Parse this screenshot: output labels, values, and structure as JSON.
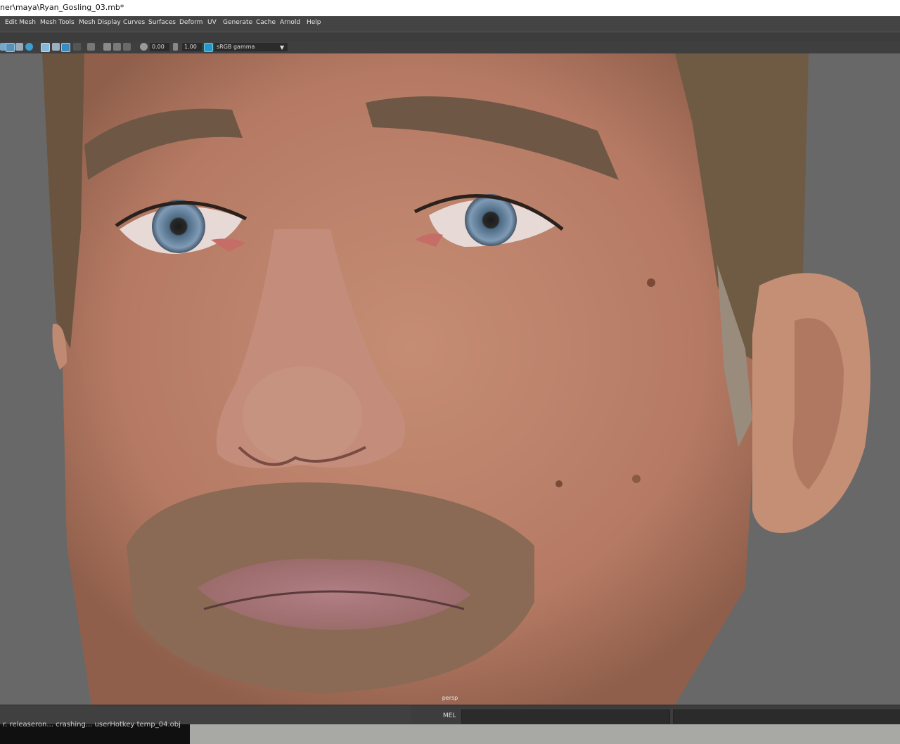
{
  "window": {
    "title": "ner\\maya\\Ryan_Gosling_03.mb*"
  },
  "menu": [
    "Edit Mesh",
    "Mesh Tools",
    "Mesh Display",
    "Curves",
    "Surfaces",
    "Deform",
    "UV",
    "Generate",
    "Cache",
    "Arnold",
    "Help"
  ],
  "toolbar": {
    "exposure": "0.00",
    "gamma": "1.00",
    "color_space": "sRGB gamma"
  },
  "viewport": {
    "camera_label": "persp"
  },
  "command_line": {
    "language": "MEL"
  },
  "status_text": "r. releaseron... crashing... userHotkey temp_04.obj"
}
